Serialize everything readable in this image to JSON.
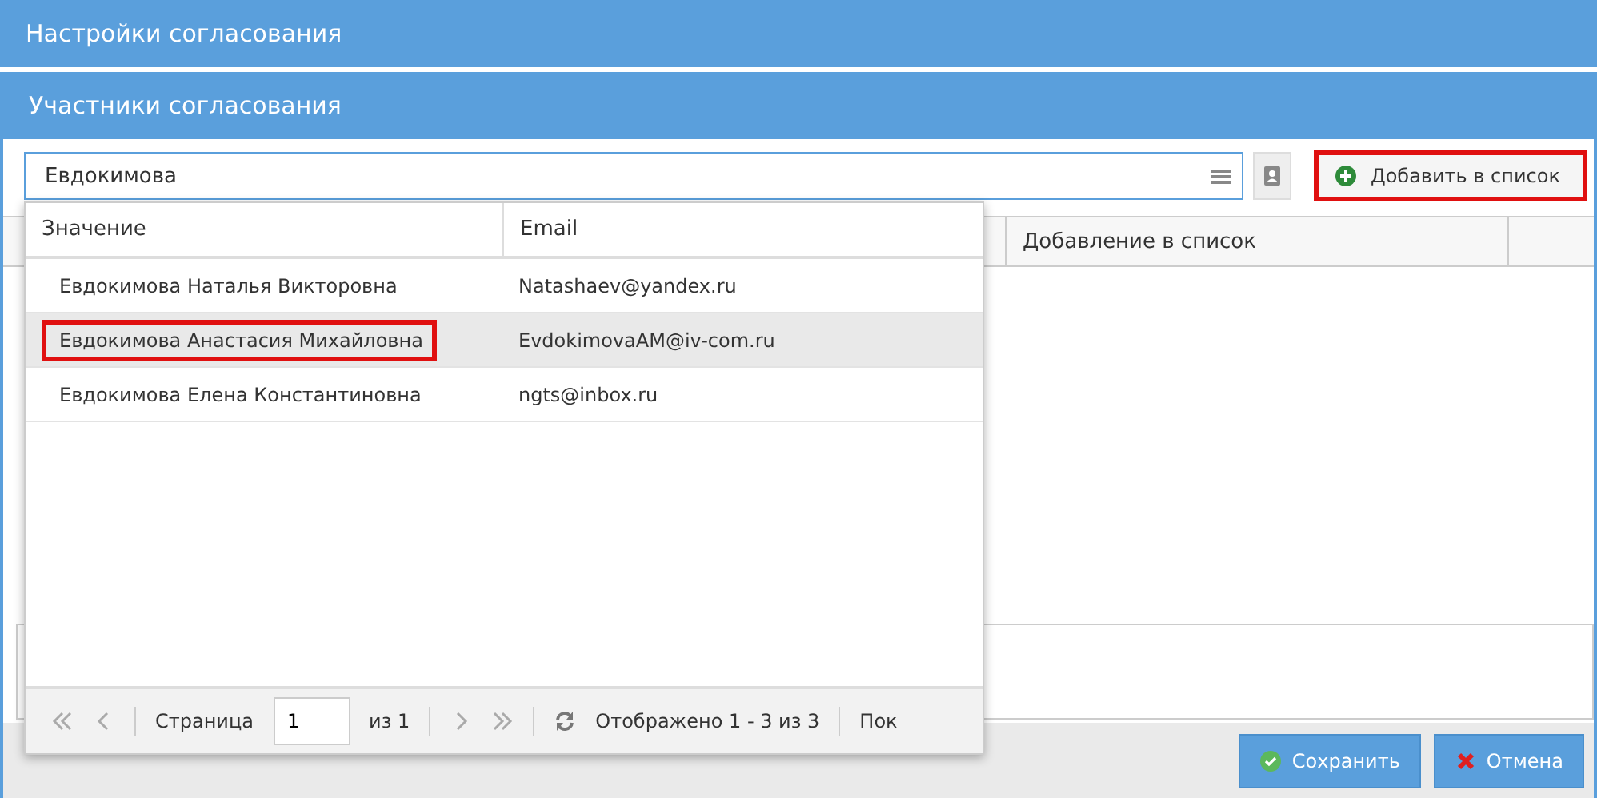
{
  "window": {
    "title": "Настройки согласования"
  },
  "section": {
    "title": "Участники согласования"
  },
  "search": {
    "value": "Евдокимова"
  },
  "add_button": {
    "label": "Добавить в список",
    "highlighted": true
  },
  "grid": {
    "columns": [
      "Добавление в список"
    ]
  },
  "dropdown": {
    "columns": [
      "Значение",
      "Email"
    ],
    "rows": [
      {
        "name": "Евдокимова Наталья Викторовна",
        "email": "Natashaev@yandex.ru",
        "selected": false,
        "highlighted": false
      },
      {
        "name": "Евдокимова Анастасия Михайловна",
        "email": "EvdokimovaAM@iv-com.ru",
        "selected": true,
        "highlighted": true
      },
      {
        "name": "Евдокимова Елена Константиновна",
        "email": "ngts@inbox.ru",
        "selected": false,
        "highlighted": false
      }
    ],
    "pager": {
      "page_label": "Страница",
      "page": "1",
      "of": "из 1",
      "summary": "Отображено 1 - 3 из 3",
      "cut": "Пок"
    }
  },
  "footer": {
    "buttons": [
      {
        "kind": "save",
        "label": "Сохранить"
      },
      {
        "kind": "cancel",
        "label": "Отмена"
      }
    ]
  }
}
